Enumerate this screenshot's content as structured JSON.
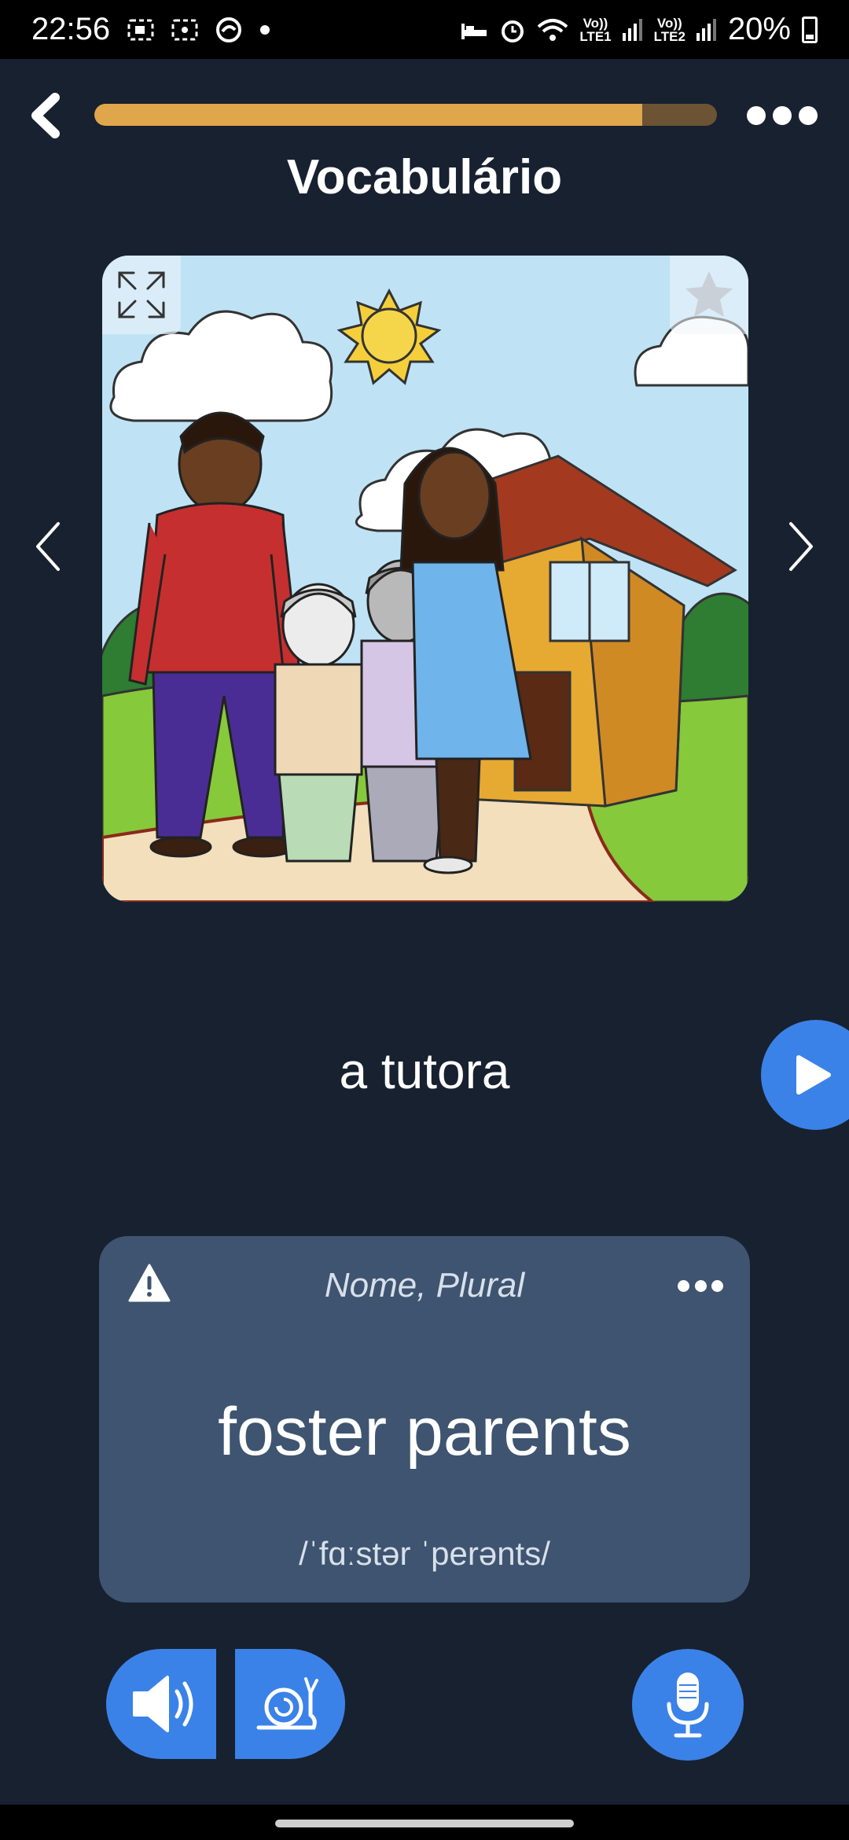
{
  "status_bar": {
    "time": "22:56",
    "sim1": "Vo))",
    "sim1_sub": "LTE1",
    "sim2": "Vo))",
    "sim2_sub": "LTE2",
    "battery": "20%"
  },
  "header": {
    "title": "Vocabulário",
    "progress_fraction": 0.88
  },
  "lesson": {
    "word": "a tutora",
    "part_of_speech": "Nome, Plural",
    "translation": "foster parents",
    "phonetic": "/ˈfɑːstər ˈperənts/"
  },
  "colors": {
    "background": "#172130",
    "accent_blue": "#3b82e8",
    "progress_fill": "#e0a64c",
    "progress_track": "#6b5333",
    "card": "#3e5470"
  },
  "icons": {
    "back": "chevron-left-icon",
    "menu": "more-dots-icon",
    "expand": "expand-icon",
    "favorite": "star-icon",
    "prev": "chevron-left-icon",
    "next": "chevron-right-icon",
    "play": "play-icon",
    "warning": "warning-icon",
    "speaker": "speaker-icon",
    "slow": "snail-icon",
    "microphone": "microphone-icon"
  }
}
